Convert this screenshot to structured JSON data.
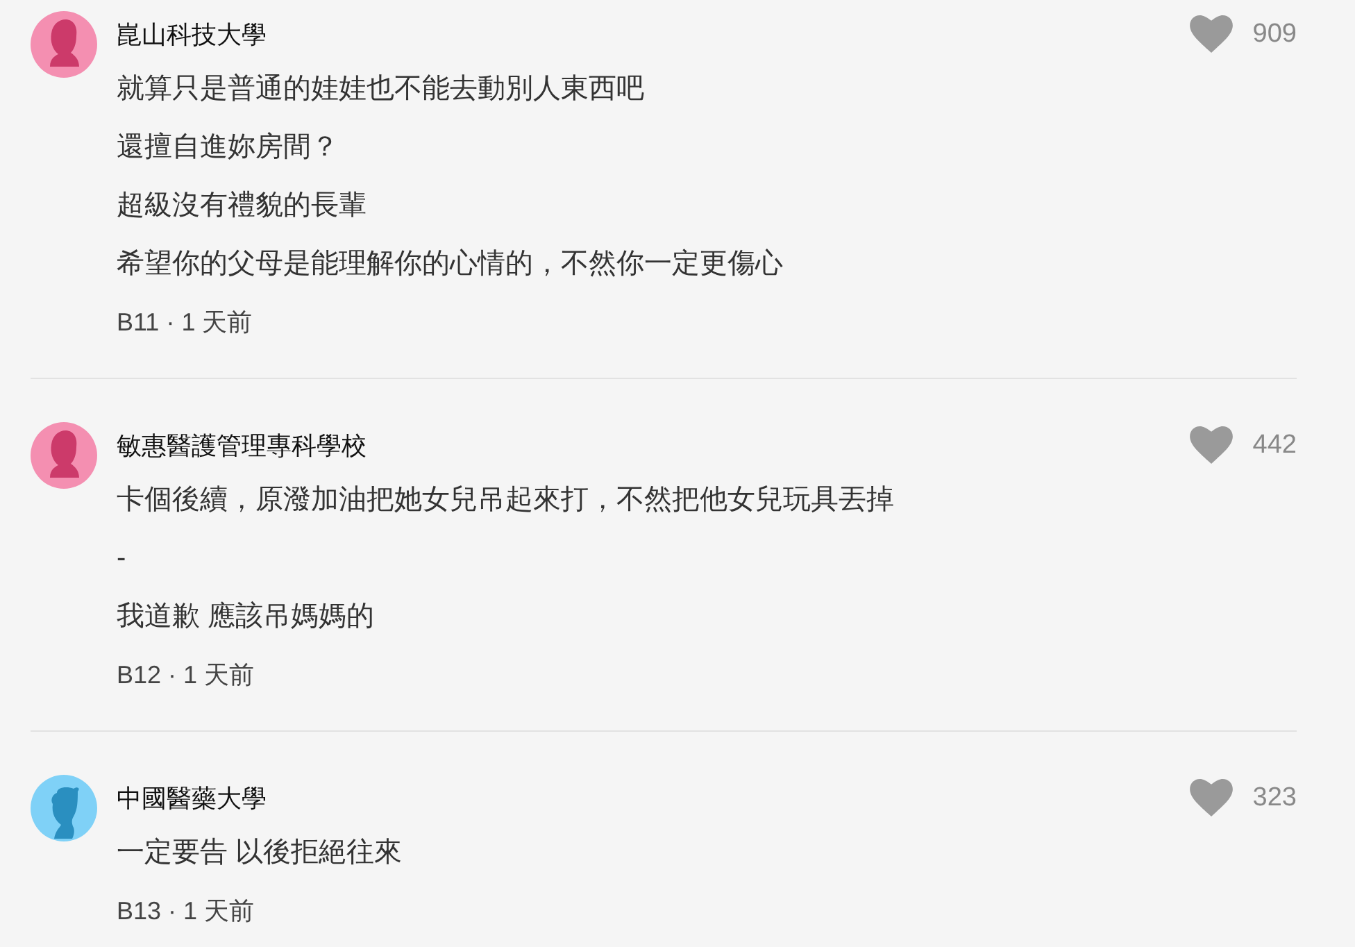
{
  "comments": [
    {
      "author": "崑山科技大學",
      "avatar": {
        "kind": "female"
      },
      "likes": "909",
      "lines": [
        "就算只是普通的娃娃也不能去動別人東西吧",
        "還擅自進妳房間？",
        "超級沒有禮貌的長輩",
        "希望你的父母是能理解你的心情的，不然你一定更傷心"
      ],
      "meta": "B11 · 1 天前"
    },
    {
      "author": "敏惠醫護管理專科學校",
      "avatar": {
        "kind": "female"
      },
      "likes": "442",
      "lines": [
        "卡個後續，原潑加油把她女兒吊起來打，不然把他女兒玩具丟掉",
        "-",
        "我道歉 應該吊媽媽的"
      ],
      "meta": "B12 · 1 天前"
    },
    {
      "author": "中國醫藥大學",
      "avatar": {
        "kind": "male"
      },
      "likes": "323",
      "lines": [
        "一定要告 以後拒絕往來"
      ],
      "meta": "B13 · 1 天前"
    }
  ]
}
